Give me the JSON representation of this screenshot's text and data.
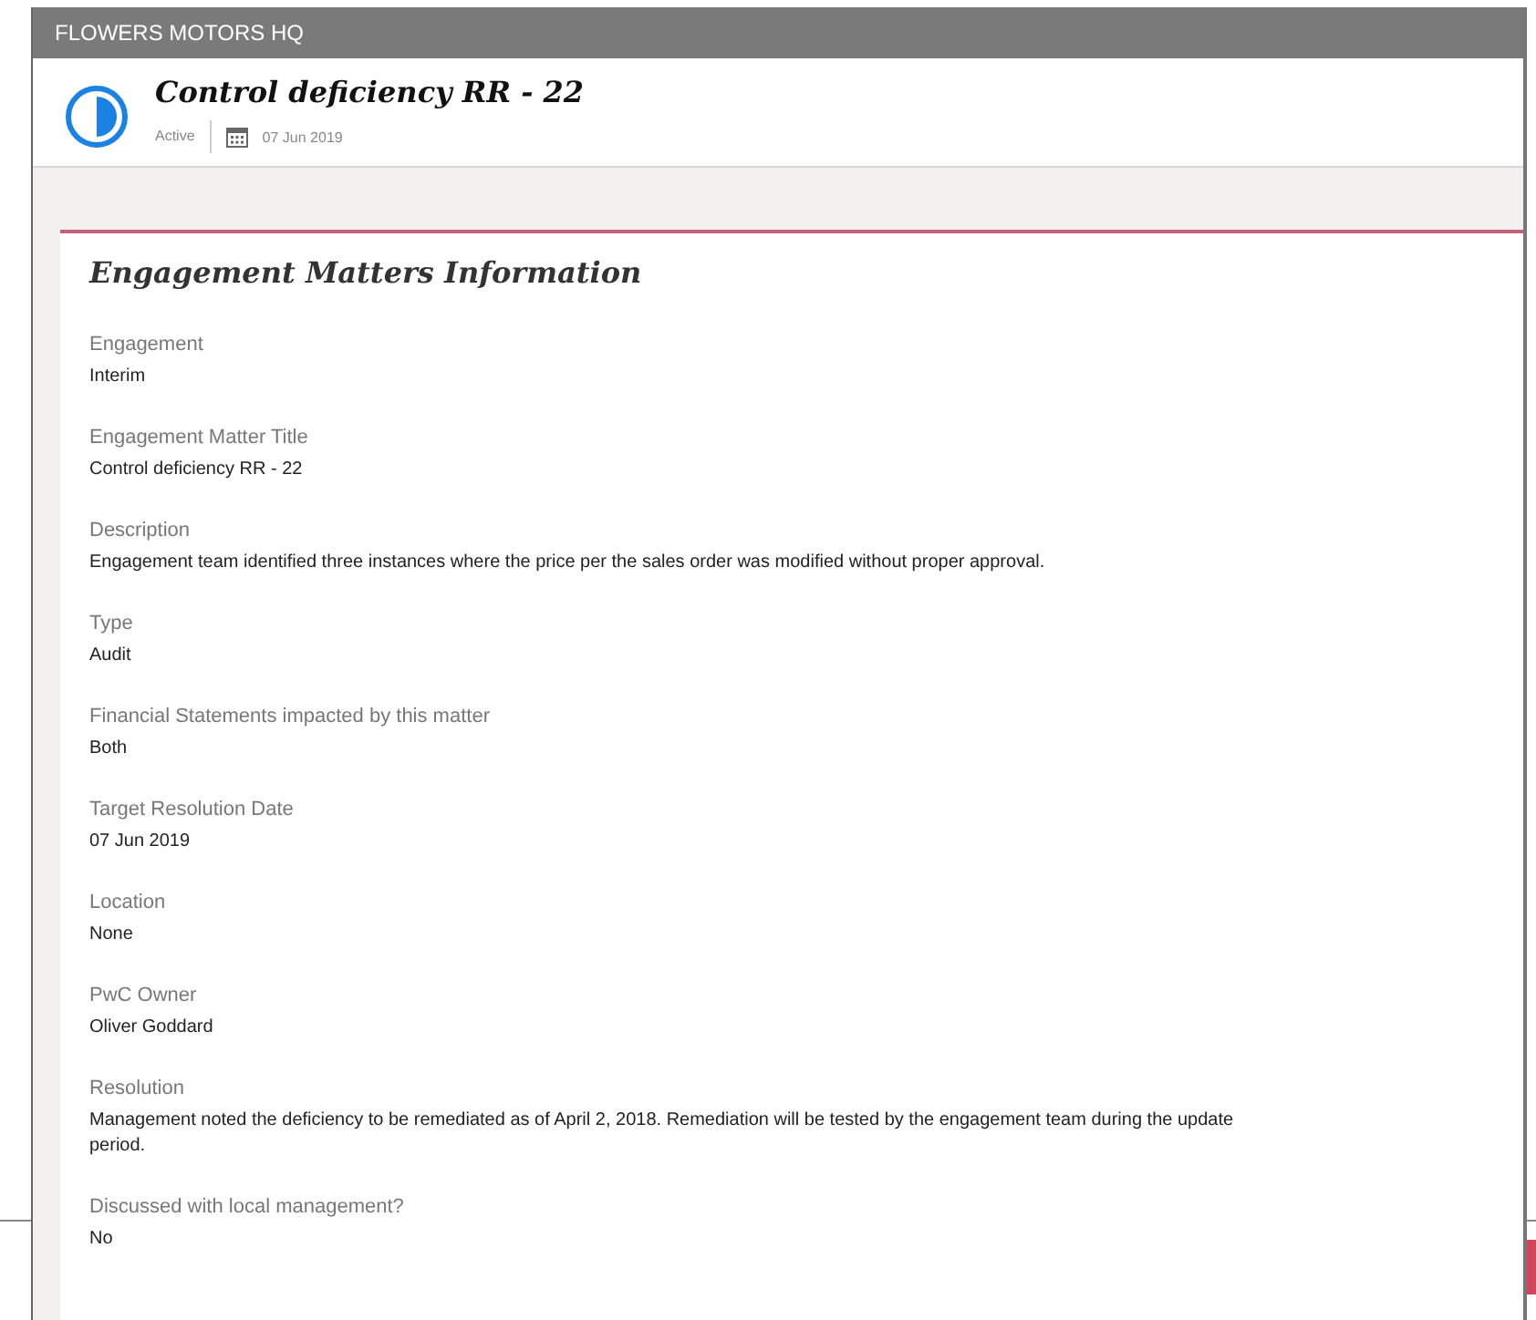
{
  "window": {
    "title": "FLOWERS MOTORS HQ"
  },
  "record": {
    "title": "Control deficiency RR - 22",
    "status": "Active",
    "date": "07 Jun 2019"
  },
  "section": {
    "title": "Engagement Matters Information",
    "fields": [
      {
        "label": "Engagement",
        "value": "Interim"
      },
      {
        "label": "Engagement Matter Title",
        "value": "Control deficiency RR - 22"
      },
      {
        "label": "Description",
        "value": "Engagement team identified three instances where the price per the sales order was modified without proper approval."
      },
      {
        "label": "Type",
        "value": "Audit"
      },
      {
        "label": "Financial Statements impacted by this matter",
        "value": "Both"
      },
      {
        "label": "Target Resolution Date",
        "value": "07 Jun 2019"
      },
      {
        "label": "Location",
        "value": "None"
      },
      {
        "label": "PwC Owner",
        "value": "Oliver Goddard"
      },
      {
        "label": "Resolution",
        "value": "Management noted the deficiency to be remediated as of April 2, 2018. Remediation will be tested by the engagement team during the update period."
      },
      {
        "label": "Discussed with local management?",
        "value": "No"
      }
    ]
  }
}
